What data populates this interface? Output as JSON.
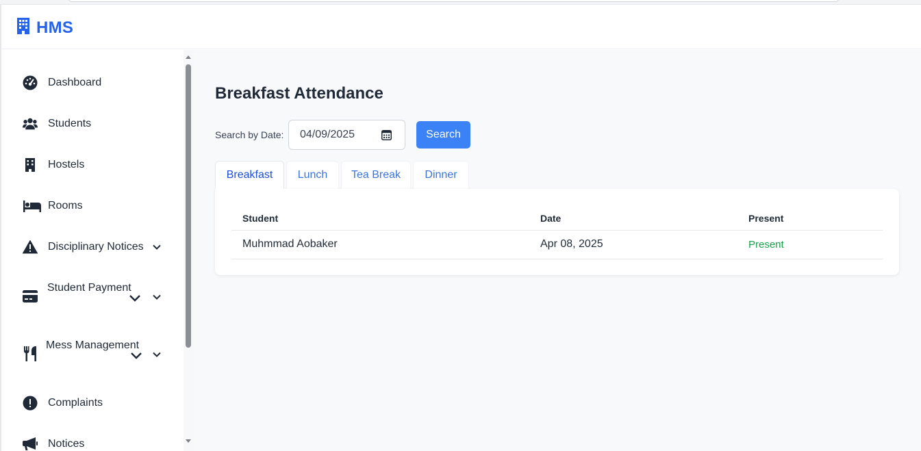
{
  "app": {
    "name": "HMS"
  },
  "sidebar": {
    "items": [
      {
        "label": "Dashboard",
        "icon": "gauge-icon"
      },
      {
        "label": "Students",
        "icon": "users-icon"
      },
      {
        "label": "Hostels",
        "icon": "building-icon"
      },
      {
        "label": "Rooms",
        "icon": "bed-icon"
      },
      {
        "label": "Disciplinary Notices",
        "icon": "warning-icon"
      },
      {
        "label": "Student Payment",
        "icon": "credit-card-icon"
      },
      {
        "label": "Mess Management",
        "icon": "utensils-icon"
      },
      {
        "label": "Complaints",
        "icon": "exclamation-circle-icon"
      },
      {
        "label": "Notices",
        "icon": "megaphone-icon"
      }
    ]
  },
  "main": {
    "title": "Breakfast Attendance",
    "search": {
      "label": "Search by Date:",
      "date_value": "04/09/2025",
      "button_label": "Search"
    },
    "tabs": [
      {
        "label": "Breakfast",
        "active": true
      },
      {
        "label": "Lunch",
        "active": false
      },
      {
        "label": "Tea Break",
        "active": false
      },
      {
        "label": "Dinner",
        "active": false
      }
    ],
    "table": {
      "columns": [
        "Student",
        "Date",
        "Present"
      ],
      "rows": [
        {
          "student": "Muhmmad Aobaker",
          "date": "Apr 08, 2025",
          "present": "Present"
        }
      ]
    }
  },
  "colors": {
    "brand": "#2563eb",
    "button": "#3b82f6",
    "present": "#16a34a",
    "active_tab": "#1d4ed8"
  }
}
